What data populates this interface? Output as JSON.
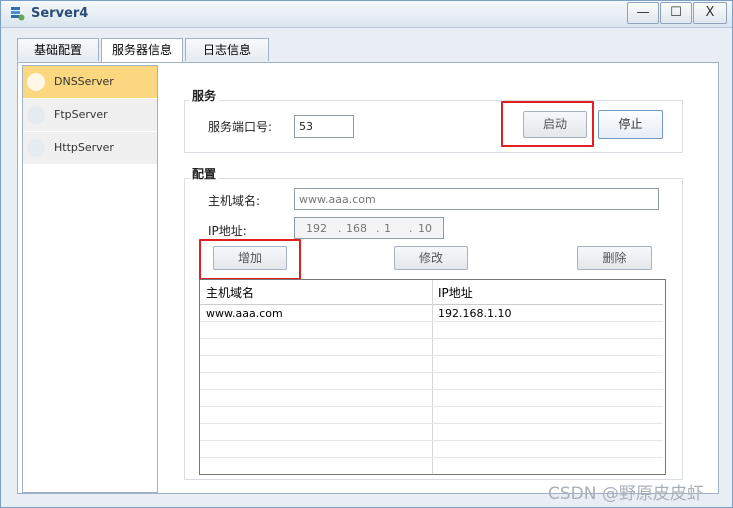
{
  "window": {
    "title": "Server4"
  },
  "window_controls": {
    "minimize": "—",
    "maximize": "☐",
    "close": "X"
  },
  "tabs": [
    {
      "label": "基础配置"
    },
    {
      "label": "服务器信息"
    },
    {
      "label": "日志信息"
    }
  ],
  "server_list": [
    {
      "label": "DNSServer",
      "selected": true
    },
    {
      "label": "FtpServer",
      "selected": false
    },
    {
      "label": "HttpServer",
      "selected": false
    }
  ],
  "service_group": {
    "title": "服务",
    "port_label": "服务端口号:",
    "port_value": "53",
    "start_label": "启动",
    "stop_label": "停止"
  },
  "config_group": {
    "title": "配置",
    "host_label": "主机域名:",
    "host_placeholder": "www.aaa.com",
    "ip_label": "IP地址:",
    "ip_octets": [
      "192",
      "168",
      "1",
      "10"
    ],
    "add_label": "增加",
    "edit_label": "修改",
    "delete_label": "删除"
  },
  "table": {
    "columns": [
      "主机域名",
      "IP地址"
    ],
    "rows": [
      [
        "www.aaa.com",
        "192.168.1.10"
      ]
    ]
  },
  "watermark": "CSDN @野原皮皮虾",
  "colors": {
    "highlight_box": "#e02020",
    "selected_item": "#fbd77f"
  }
}
